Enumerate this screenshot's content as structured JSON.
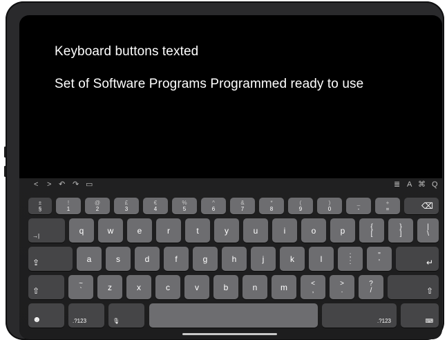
{
  "content": {
    "lines": [
      "Keyboard buttons texted",
      "Set of Software Programs Programmed ready to use"
    ]
  },
  "toolbar": {
    "left": [
      "<",
      ">",
      "↶",
      "↷",
      "▭"
    ],
    "right": [
      "≣",
      "A",
      "⌘",
      "Q"
    ]
  },
  "keyboard": {
    "number_row": [
      [
        "±",
        "§"
      ],
      [
        "!",
        "1"
      ],
      [
        "@",
        "2"
      ],
      [
        "£",
        "3"
      ],
      [
        "€",
        "4"
      ],
      [
        "%",
        "5"
      ],
      [
        "^",
        "6"
      ],
      [
        "&",
        "7"
      ],
      [
        "*",
        "8"
      ],
      [
        "(",
        "9"
      ],
      [
        ")",
        "0"
      ],
      [
        "_",
        "-"
      ],
      [
        "+",
        "="
      ]
    ],
    "delete": "⌫",
    "tab": "→|",
    "row_q": [
      "q",
      "w",
      "e",
      "r",
      "t",
      "y",
      "u",
      "i",
      "o",
      "p"
    ],
    "row_q_extra": [
      [
        "{",
        "["
      ],
      [
        "}",
        "]"
      ],
      [
        "|",
        "\\"
      ]
    ],
    "caps": "⇪",
    "row_a": [
      "a",
      "s",
      "d",
      "f",
      "g",
      "h",
      "j",
      "k",
      "l"
    ],
    "row_a_extra": [
      [
        ";",
        ":"
      ],
      [
        "\"",
        "'"
      ]
    ],
    "return": "↵",
    "shift": "⇧",
    "row_z": [
      "`~",
      "z",
      "x",
      "c",
      "v",
      "b",
      "n",
      "m"
    ],
    "row_z_tilde": [
      "~",
      "`"
    ],
    "row_z_extra": [
      [
        "<",
        ","
      ],
      [
        ">",
        "."
      ],
      [
        "?",
        "/"
      ]
    ],
    "emoji": "☻",
    "num_label": ".?123",
    "mic": "🎙",
    "num_label_right": ".?123",
    "hide_kb": "⌨"
  }
}
